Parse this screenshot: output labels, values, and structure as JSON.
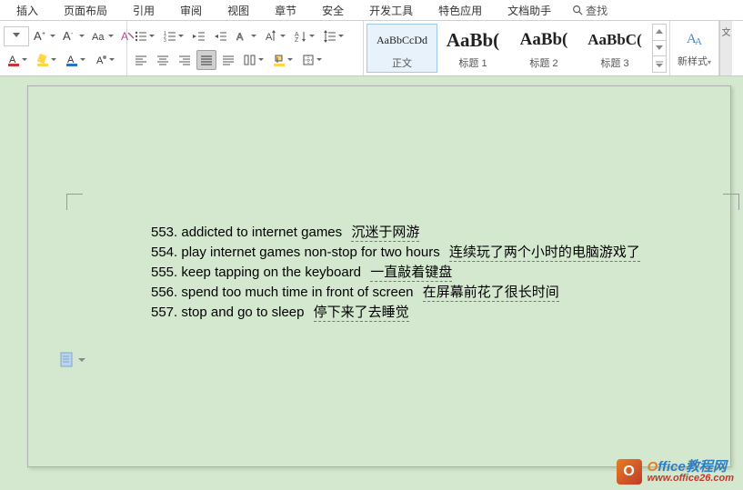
{
  "menu": {
    "items": [
      "插入",
      "页面布局",
      "引用",
      "审阅",
      "视图",
      "章节",
      "安全",
      "开发工具",
      "特色应用",
      "文档助手"
    ],
    "search_label": "查找"
  },
  "toolbar": {
    "icons": {
      "format_painter": "格式刷",
      "font_size_inc": "A+",
      "font_size_dec": "A-"
    }
  },
  "styles": {
    "items": [
      {
        "preview": "AaBbCcDd",
        "label": "正文",
        "size": "12px",
        "selected": true
      },
      {
        "preview": "AaBb(",
        "label": "标题 1",
        "size": "21px",
        "weight": "bold"
      },
      {
        "preview": "AaBb(",
        "label": "标题 2",
        "size": "19px",
        "weight": "bold"
      },
      {
        "preview": "AaBbC(",
        "label": "标题 3",
        "size": "17px",
        "weight": "bold"
      }
    ],
    "new_style_label": "新样式"
  },
  "right_strip": "文",
  "document": {
    "lines": [
      {
        "num": "553.",
        "en": "addicted to internet games",
        "cn": "沉迷于网游"
      },
      {
        "num": "554.",
        "en": "play internet games non-stop for two hours",
        "cn": "连续玩了两个小时的电脑游戏了"
      },
      {
        "num": "555.",
        "en": "keep tapping on the keyboard",
        "cn": "一直敲着键盘"
      },
      {
        "num": "556.",
        "en": "spend too much time in front of screen",
        "cn": "在屏幕前花了很长时间"
      },
      {
        "num": "557.",
        "en": "stop and go to sleep",
        "cn": "停下来了去睡觉"
      }
    ]
  },
  "watermark": {
    "title_o": "O",
    "title_rest": "ffice教程网",
    "url": "www.office26.com",
    "logo_text": "O"
  }
}
